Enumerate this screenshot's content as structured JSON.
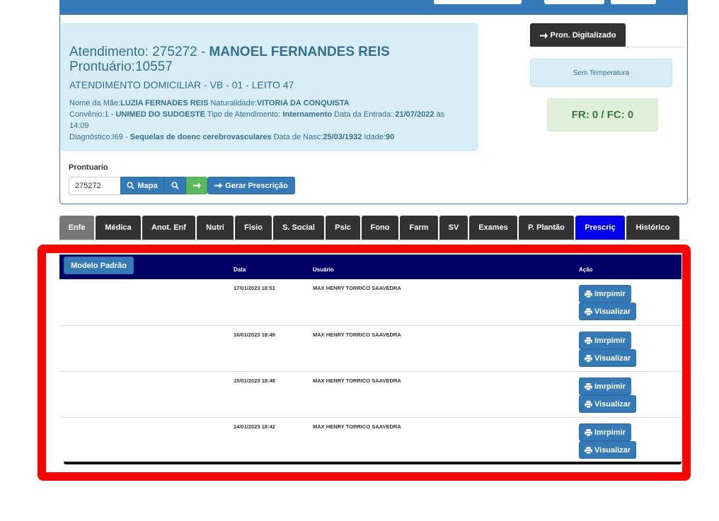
{
  "header": {
    "atendimento_label": "Atendimento: 275272 - ",
    "patient_name": "MANOEL FERNANDES REIS",
    "prontuario_line": "Prontuário:10557",
    "unit_line": "ATENDIMENTO DOMICILIAR - VB - 01 - LEITO 47",
    "mae_label": "Nome da Mãe:",
    "mae_value": "LUZIA FERNADES REIS",
    "naturalidade_label": " Naturalidade:",
    "naturalidade_value": "VITORIA DA CONQUISTA",
    "convenio_label": "Convênio:1 - ",
    "convenio_value": "UNIMED DO SUDOESTE",
    "tipo_label": " Tipo de Atendimento: ",
    "tipo_value": "Internamento",
    "entrada_label": " Data da Entrada: ",
    "entrada_value": "21/07/2022",
    "entrada_time": " às 14:09",
    "diagnostico_label": "Diagnóstico:I69 - ",
    "diagnostico_value": "Sequelas de doenc cerebrovasculares",
    "nasc_label": " Data de Nasc:",
    "nasc_value": "25/03/1932",
    "idade_label": " Idade:",
    "idade_value": "90"
  },
  "side": {
    "pron_digitalizado": "Pron. Digitalizado",
    "temperatura": "Sem Temperatura",
    "vitals": "FR: 0 / FC: 0"
  },
  "prontuario": {
    "label": "Prontuario",
    "value": "275272",
    "mapa": "Mapa",
    "gerar": "Gerar Prescrição"
  },
  "tabs": [
    "Enfe",
    "Médica",
    "Anot. Enf",
    "Nutri",
    "Fisio",
    "S. Social",
    "Psic",
    "Fono",
    "Farm",
    "SV",
    "Exames",
    "P. Plantão",
    "Prescriç",
    "Histórico"
  ],
  "table": {
    "modelo_button": "Modelo Padrão",
    "headers": {
      "data": "Data",
      "usuario": "Usuário",
      "acao": "Ação"
    },
    "print_label": "Imrpimir",
    "view_label": "Visualizar",
    "rows": [
      {
        "data": "17/01/2023 18:51",
        "usuario": "MAX HENRY TORRICO SAAVEDRA"
      },
      {
        "data": "16/01/2023 18:49",
        "usuario": "MAX HENRY TORRICO SAAVEDRA"
      },
      {
        "data": "15/01/2023 18:48",
        "usuario": "MAX HENRY TORRICO SAAVEDRA"
      },
      {
        "data": "14/01/2023 18:42",
        "usuario": "MAX HENRY TORRICO SAAVEDRA"
      }
    ]
  },
  "colors": {
    "primary": "#337ab7",
    "table_header": "#000066",
    "highlight_border": "#ff0000",
    "active_tab": "#0000ee"
  }
}
